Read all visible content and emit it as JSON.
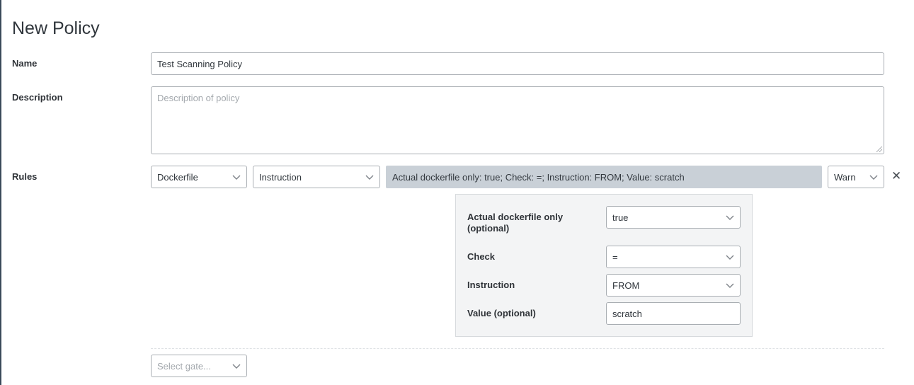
{
  "page": {
    "title": "New Policy"
  },
  "form": {
    "name_label": "Name",
    "name_value": "Test Scanning Policy",
    "description_label": "Description",
    "description_placeholder": "Description of policy",
    "rules_label": "Rules"
  },
  "rule": {
    "gate": "Dockerfile",
    "trigger": "Instruction",
    "summary": "Actual dockerfile only: true; Check: =; Instruction: FROM; Value: scratch",
    "action": "Warn",
    "remove_glyph": "✕",
    "params": {
      "actual_only_label_line1": "Actual dockerfile only",
      "actual_only_label_line2": "(optional)",
      "actual_only_value": "true",
      "check_label": "Check",
      "check_value": "=",
      "instruction_label": "Instruction",
      "instruction_value": "FROM",
      "value_label": "Value (optional)",
      "value_value": "scratch"
    }
  },
  "new_rule": {
    "gate_placeholder": "Select gate..."
  },
  "icons": {
    "dropdown": "chevron-down-icon",
    "remove": "close-icon"
  },
  "colors": {
    "summary_bg": "#c9d0d7",
    "panel_bg": "#f3f4f5",
    "border": "#a9aeb3"
  }
}
